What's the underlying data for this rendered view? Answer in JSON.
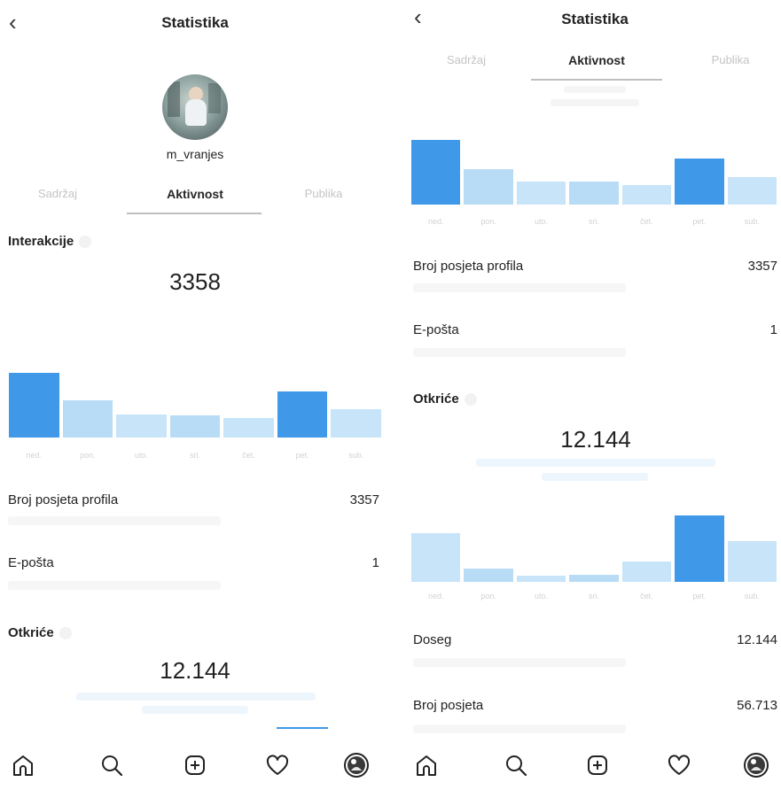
{
  "left": {
    "title": "Statistika",
    "username": "m_vranjes",
    "tabs": [
      "Sadržaj",
      "Aktivnost",
      "Publika"
    ],
    "interactions": {
      "heading": "Interakcije",
      "total": "3358",
      "days": [
        "ned.",
        "pon.",
        "uto.",
        "sri.",
        "čet.",
        "pet.",
        "sub."
      ],
      "values": [
        1.0,
        0.58,
        0.36,
        0.34,
        0.3,
        0.71,
        0.44
      ],
      "highlight": [
        0,
        5
      ]
    },
    "rows": [
      {
        "label": "Broj posjeta profila",
        "value": "3357"
      },
      {
        "label": "E-pošta",
        "value": "1"
      }
    ],
    "discovery": {
      "heading": "Otkriće",
      "total": "12.144"
    }
  },
  "right": {
    "title": "Statistika",
    "tabs": [
      "Sadržaj",
      "Aktivnost",
      "Publika"
    ],
    "top_chart": {
      "values": [
        1.0,
        0.55,
        0.36,
        0.36,
        0.3,
        0.71,
        0.42
      ],
      "highlight": [
        0,
        5
      ],
      "days": [
        "ned.",
        "pon.",
        "uto.",
        "sri.",
        "čet.",
        "pet.",
        "sub."
      ]
    },
    "rows_top": [
      {
        "label": "Broj posjeta profila",
        "value": "3357"
      },
      {
        "label": "E-pošta",
        "value": "1"
      }
    ],
    "discovery": {
      "heading": "Otkriće",
      "total": "12.144",
      "days": [
        "ned.",
        "pon.",
        "uto.",
        "sri.",
        "čet.",
        "pet.",
        "sub."
      ],
      "values": [
        0.74,
        0.2,
        0.1,
        0.11,
        0.31,
        1.0,
        0.61
      ],
      "highlight": [
        5
      ]
    },
    "rows_bottom": [
      {
        "label": "Doseg",
        "value": "12.144"
      },
      {
        "label": "Broj posjeta",
        "value": "56.713"
      }
    ]
  },
  "nav": {
    "icons": [
      "home-icon",
      "search-icon",
      "new-post-icon",
      "activity-heart-icon",
      "profile-avatar-icon"
    ]
  },
  "colors": {
    "bar_strong": "#3f98e8",
    "bar_light": "#c7e4f9",
    "bar_light2": "#b8dcf6"
  }
}
